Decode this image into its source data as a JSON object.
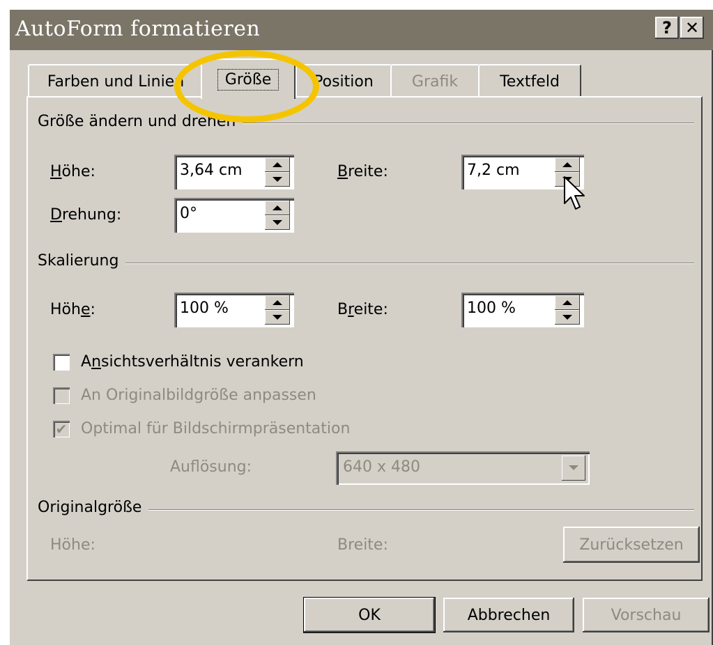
{
  "window": {
    "title": "AutoForm formatieren",
    "help_label": "?",
    "close_label": "✕"
  },
  "tabs": [
    {
      "label": "Farben und Linien",
      "state": "normal"
    },
    {
      "label": "Größe",
      "state": "active"
    },
    {
      "label": "Position",
      "state": "normal"
    },
    {
      "label": "Grafik",
      "state": "disabled"
    },
    {
      "label": "Textfeld",
      "state": "normal"
    }
  ],
  "size_rotate": {
    "heading": "Größe ändern und drehen",
    "height_label_accel": "H",
    "height_label_rest": "öhe:",
    "height_value": "3,64 cm",
    "width_label_accel": "B",
    "width_label_rest": "reite:",
    "width_value": "7,2 cm",
    "rotation_label_accel": "D",
    "rotation_label_rest": "rehung:",
    "rotation_value": "0°"
  },
  "scaling": {
    "heading": "Skalierung",
    "height_label_pre": "Höh",
    "height_label_accel": "e",
    "height_label_post": ":",
    "height_value": "100 %",
    "width_label_pre": "B",
    "width_label_accel": "r",
    "width_label_post": "eite:",
    "width_value": "100 %",
    "lock_aspect_pre": "A",
    "lock_aspect_accel": "n",
    "lock_aspect_post": "sichtsverhältnis verankern",
    "lock_aspect_checked": false,
    "relative_original": "An Originalbildgröße anpassen",
    "relative_original_checked": false,
    "best_scale": "Optimal für Bildschirmpräsentation",
    "best_scale_checked": true,
    "resolution_label": "Auflösung:",
    "resolution_value": "640 x 480"
  },
  "original_size": {
    "heading": "Originalgröße",
    "height_label": "Höhe:",
    "width_label": "Breite:",
    "reset_label": "Zurücksetzen"
  },
  "buttons": {
    "ok": "OK",
    "cancel": "Abbrechen",
    "preview": "Vorschau"
  },
  "colors": {
    "dialog_bg": "#d4d0c8",
    "titlebar": "#7b7568",
    "highlight_circle": "#f5c400",
    "disabled_text": "#8e8a82"
  }
}
